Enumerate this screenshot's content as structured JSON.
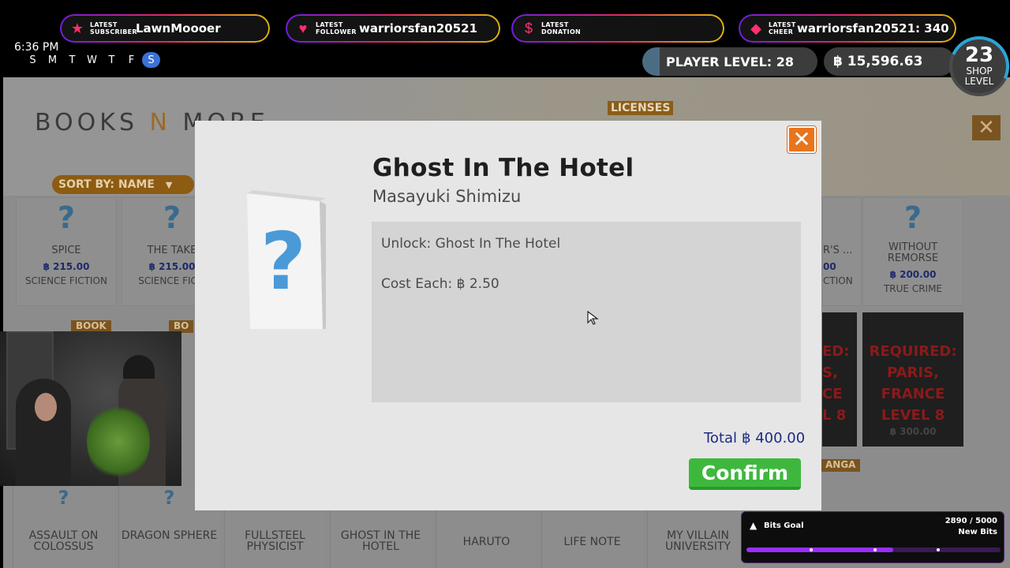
{
  "stream_bar": {
    "alerts": [
      {
        "kind": "LATEST SUBSCRIBER",
        "value": "LawnMoooer",
        "icon": "star-icon",
        "icon_color": "#ff2f6e"
      },
      {
        "kind": "LATEST FOLLOWER",
        "value": "warriorsfan20521",
        "icon": "heart-icon",
        "icon_color": "#ff2f6e"
      },
      {
        "kind": "LATEST DONATION",
        "value": "",
        "icon": "dollar-icon",
        "icon_color": "#ff2f6e"
      },
      {
        "kind": "LATEST CHEER",
        "value": "warriorsfan20521: 340",
        "icon": "diamond-icon",
        "icon_color": "#ff2f6e"
      }
    ]
  },
  "hud": {
    "time": "6:36 PM",
    "weekdays": [
      "S",
      "M",
      "T",
      "W",
      "T",
      "F",
      "S"
    ],
    "active_day_index": 6,
    "player_level_label": "PLAYER LEVEL:",
    "player_level": "28",
    "player_level_progress": 0.1,
    "money": "฿ 15,596.63",
    "shop_level": "23",
    "shop_level_label_1": "SHOP",
    "shop_level_label_2": "LEVEL"
  },
  "shop": {
    "brand_1": "BOOKS",
    "brand_n": "N",
    "brand_2": "MORE",
    "licenses_tab": "LICENSES",
    "sort_label": "SORT BY: NAME",
    "close_symbol": "✕",
    "top_cards": [
      {
        "title": "SPICE",
        "price": "฿ 215.00",
        "genre": "SCIENCE FICTION"
      },
      {
        "title": "THE TAKE",
        "price": "฿ 215.00",
        "genre": "SCIENCE FICTI"
      }
    ],
    "partial_card": {
      "title": "R'S ...",
      "price": "00",
      "genre": "CTION"
    },
    "right_card": {
      "title": "WITHOUT REMORSE",
      "price": "฿ 200.00",
      "genre": "TRUE CRIME"
    },
    "required_card": {
      "line1": "REQUIRED:",
      "line2": "PARIS,",
      "line3": "FRANCE",
      "line4": "LEVEL 8",
      "price": "฿ 300.00"
    },
    "partial_required": {
      "line1": "ED:",
      "line2": "S,",
      "line3": "CE",
      "line4": "L 8"
    },
    "book_tag": "BOOK",
    "book_tag_2": "BO",
    "manga_tag": "ANGA",
    "bottom_cards": [
      {
        "title": "ASSAULT ON COLOSSUS"
      },
      {
        "title": "DRAGON SPHERE"
      },
      {
        "title": "FULLSTEEL PHYSICIST"
      },
      {
        "title": "GHOST IN THE HOTEL"
      },
      {
        "title": "HARUTO"
      },
      {
        "title": "LIFE NOTE"
      },
      {
        "title": "MY VILLAIN UNIVERSITY"
      }
    ]
  },
  "modal": {
    "title": "Ghost In The Hotel",
    "author": "Masayuki Shimizu",
    "unlock_line": "Unlock: Ghost In The Hotel",
    "cost_label": "Cost Each:",
    "cost_value": "฿ 2.50",
    "total_label": "Total",
    "total_value": "฿ 400.00",
    "confirm_label": "Confirm",
    "close_symbol": "✕"
  },
  "bits_goal": {
    "title": "Bits Goal",
    "count": "2890 / 5000",
    "subtitle": "New Bits",
    "progress": 0.578
  },
  "colors": {
    "accent_orange": "#e8751c",
    "confirm_green": "#3db83d",
    "price_blue": "#1e2a86",
    "bits_purple": "#9b2dff"
  }
}
